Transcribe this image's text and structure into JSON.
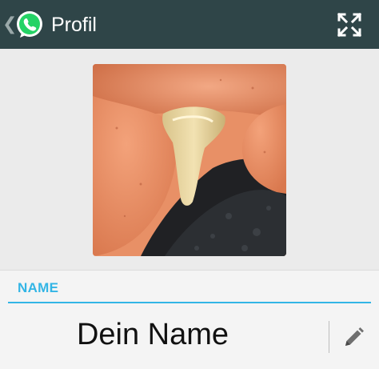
{
  "header": {
    "title": "Profil",
    "back_icon": "chevron-left-icon",
    "app_logo": "whatsapp-logo-icon",
    "expand_icon": "fullscreen-expand-icon",
    "bar_color": "#2f4548"
  },
  "profile": {
    "photo_icon": "profile-photo"
  },
  "name_section": {
    "label": "NAME",
    "value": "Dein Name",
    "edit_icon": "pencil-icon",
    "accent_color": "#33b5e5"
  }
}
